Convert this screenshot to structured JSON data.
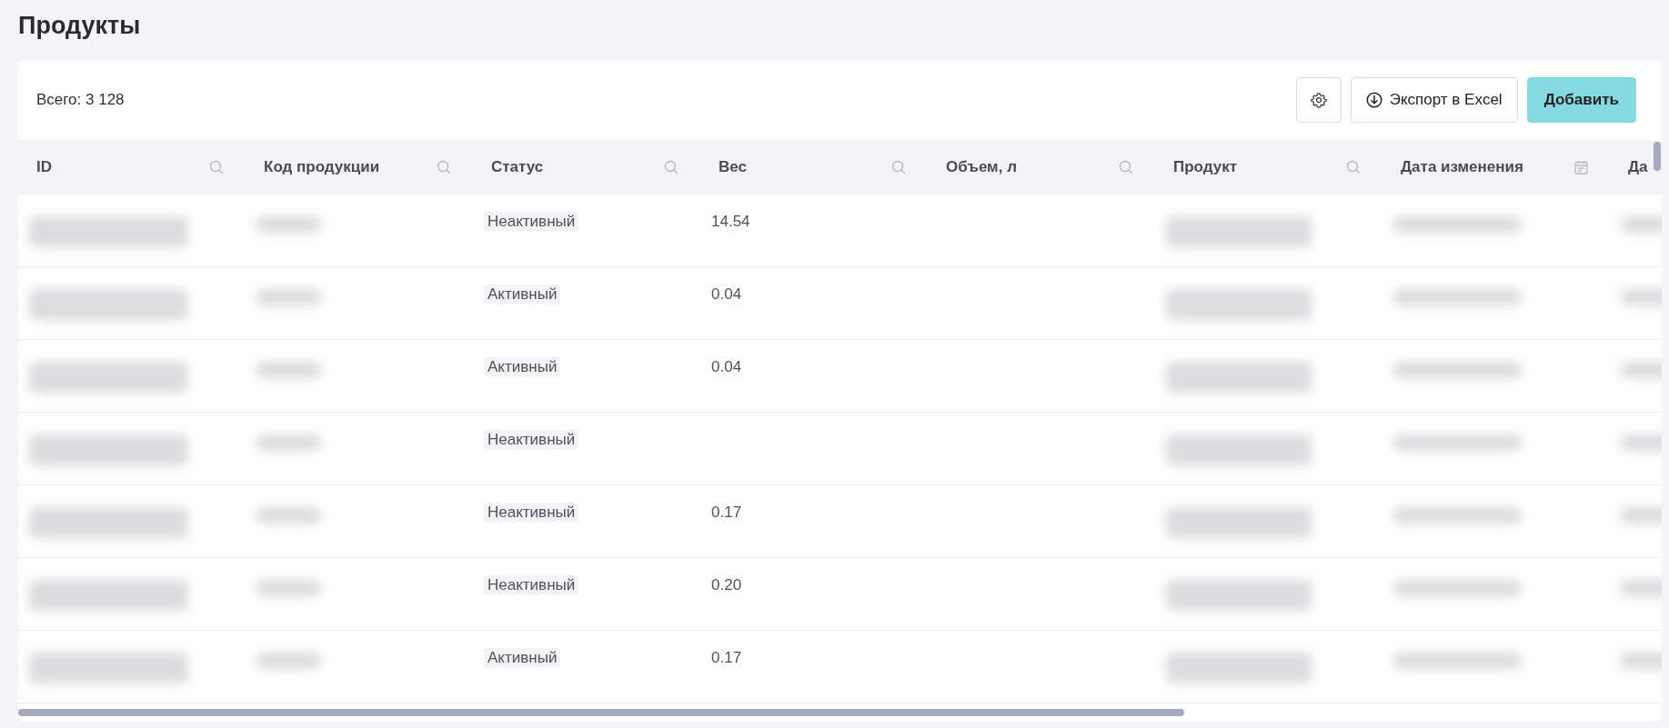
{
  "page_title": "Продукты",
  "toolbar": {
    "total": "Всего: 3 128",
    "export_button": "Экспорт в Excel",
    "add_button": "Добавить"
  },
  "table": {
    "columns": [
      {
        "label": "ID",
        "kind": "search"
      },
      {
        "label": "Код продукции",
        "kind": "search"
      },
      {
        "label": "Статус",
        "kind": "search"
      },
      {
        "label": "Вес",
        "kind": "search"
      },
      {
        "label": "Объем, л",
        "kind": "search"
      },
      {
        "label": "Продукт",
        "kind": "search"
      },
      {
        "label": "Дата изменения",
        "kind": "date"
      },
      {
        "label": "Да",
        "kind": "plain"
      }
    ],
    "rows": [
      {
        "status": "Неактивный",
        "weight": "14.54"
      },
      {
        "status": "Активный",
        "weight": "0.04"
      },
      {
        "status": "Активный",
        "weight": "0.04"
      },
      {
        "status": "Неактивный"
      },
      {
        "status": "Неактивный",
        "weight": "0.17"
      },
      {
        "status": "Неактивный",
        "weight": "0.20"
      },
      {
        "status": "Активный",
        "weight": "0.17"
      }
    ]
  }
}
